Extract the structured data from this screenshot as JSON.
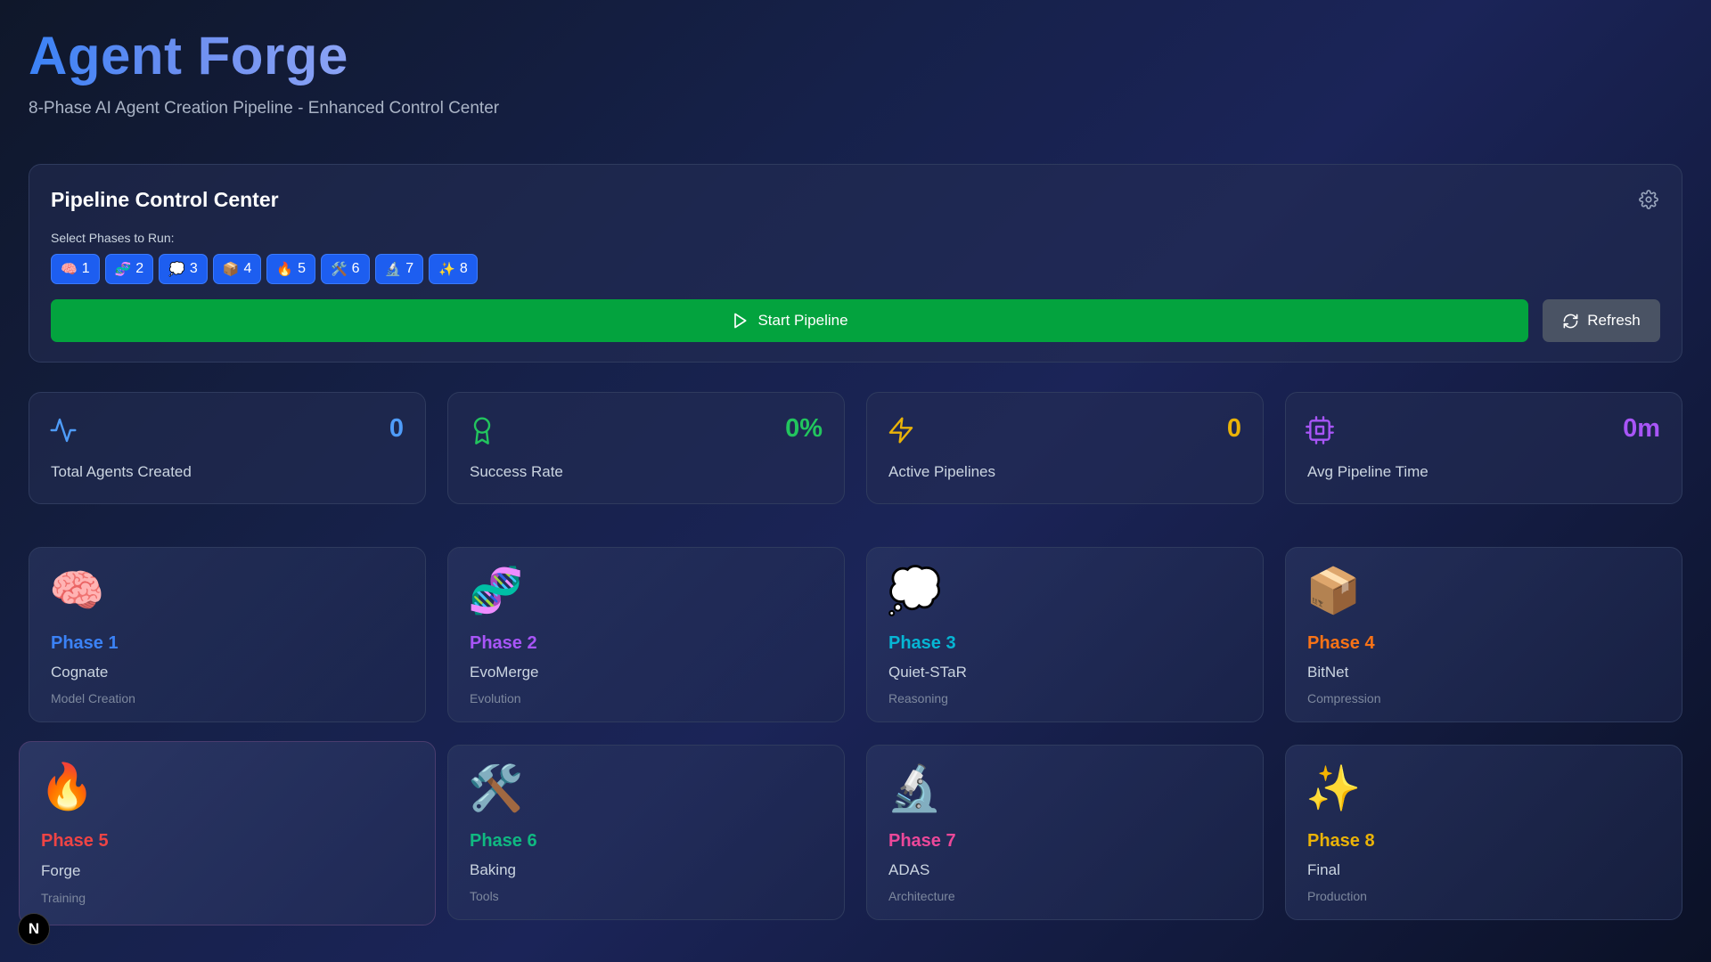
{
  "header": {
    "title": "Agent Forge",
    "subtitle": "8-Phase AI Agent Creation Pipeline - Enhanced Control Center"
  },
  "control_center": {
    "title": "Pipeline Control Center",
    "settings_icon": "gear-icon",
    "select_label": "Select Phases to Run:",
    "phase_toggles": [
      {
        "emoji": "🧠",
        "label": "1",
        "selected": true
      },
      {
        "emoji": "🧬",
        "label": "2",
        "selected": true
      },
      {
        "emoji": "💭",
        "label": "3",
        "selected": true
      },
      {
        "emoji": "📦",
        "label": "4",
        "selected": true
      },
      {
        "emoji": "🔥",
        "label": "5",
        "selected": true
      },
      {
        "emoji": "🛠️",
        "label": "6",
        "selected": true
      },
      {
        "emoji": "🔬",
        "label": "7",
        "selected": true
      },
      {
        "emoji": "✨",
        "label": "8",
        "selected": true
      }
    ],
    "start_label": "Start Pipeline",
    "refresh_label": "Refresh"
  },
  "stats": [
    {
      "label": "Total Agents Created",
      "value": "0",
      "icon": "activity-icon",
      "color": "#4f9cf9"
    },
    {
      "label": "Success Rate",
      "value": "0%",
      "icon": "award-icon",
      "color": "#22c55e"
    },
    {
      "label": "Active Pipelines",
      "value": "0",
      "icon": "zap-icon",
      "color": "#eab308"
    },
    {
      "label": "Avg Pipeline Time",
      "value": "0m",
      "icon": "cpu-icon",
      "color": "#a855f7"
    }
  ],
  "phases": [
    {
      "emoji": "🧠",
      "name": "Phase 1",
      "method": "Cognate",
      "type": "Model Creation",
      "color": "#3b82f6"
    },
    {
      "emoji": "🧬",
      "name": "Phase 2",
      "method": "EvoMerge",
      "type": "Evolution",
      "color": "#a855f7"
    },
    {
      "emoji": "💭",
      "name": "Phase 3",
      "method": "Quiet-STaR",
      "type": "Reasoning",
      "color": "#06b6d4"
    },
    {
      "emoji": "📦",
      "name": "Phase 4",
      "method": "BitNet",
      "type": "Compression",
      "color": "#f97316"
    },
    {
      "emoji": "🔥",
      "name": "Phase 5",
      "method": "Forge",
      "type": "Training",
      "color": "#ef4444"
    },
    {
      "emoji": "🛠️",
      "name": "Phase 6",
      "method": "Baking",
      "type": "Tools",
      "color": "#10b981"
    },
    {
      "emoji": "🔬",
      "name": "Phase 7",
      "method": "ADAS",
      "type": "Architecture",
      "color": "#ec4899"
    },
    {
      "emoji": "✨",
      "name": "Phase 8",
      "method": "Final",
      "type": "Production",
      "color": "#eab308"
    }
  ],
  "dev_badge": {
    "label": "N"
  }
}
